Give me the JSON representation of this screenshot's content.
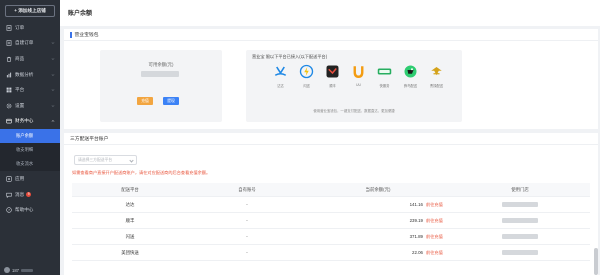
{
  "sidebar": {
    "add_store": "+ 添加线上店铺",
    "items": [
      {
        "label": "订单",
        "icon": "order-icon"
      },
      {
        "label": "自建订单",
        "icon": "create-order-icon"
      },
      {
        "label": "商品",
        "icon": "goods-icon"
      },
      {
        "label": "数据分析",
        "icon": "chart-icon"
      },
      {
        "label": "平台",
        "icon": "platform-icon"
      },
      {
        "label": "设置",
        "icon": "settings-icon"
      },
      {
        "label": "财务中心",
        "icon": "finance-icon"
      }
    ],
    "sub_items": [
      {
        "label": "账户余额",
        "active": true
      },
      {
        "label": "收支明细",
        "active": false
      },
      {
        "label": "收支流水",
        "active": false
      }
    ],
    "bottom_items": [
      {
        "label": "应用",
        "icon": "app-icon"
      },
      {
        "label": "消息",
        "icon": "message-icon",
        "badge": "9"
      },
      {
        "label": "帮助中心",
        "icon": "help-icon"
      }
    ],
    "user": {
      "name": "187"
    }
  },
  "page": {
    "title": "账户余额"
  },
  "wallet": {
    "section_title": "营业宝钱包",
    "balance_label": "可用余额(元)",
    "recharge_label": "充值",
    "withdraw_label": "提现"
  },
  "platforms": {
    "tip": "营业宝 限以下平台已接入(以下配送平台)",
    "list": [
      {
        "name": "达达",
        "color": "#1e88e5"
      },
      {
        "name": "闪送",
        "color": "#1e88e5"
      },
      {
        "name": "顺丰",
        "color": "#222222"
      },
      {
        "name": "UU",
        "color": "#f39c12"
      },
      {
        "name": "快服务",
        "color": "#27ae60"
      },
      {
        "name": "蜂鸟配送",
        "color": "#27ae60"
      },
      {
        "name": "曹操配送",
        "color": "#d4a21a"
      }
    ],
    "note": "使用营业宝钱包，一键支付配送，数据直达、更加便捷"
  },
  "third_party": {
    "section_title": "三方配送平台账户",
    "select_placeholder": "请选择三方配送平台",
    "warning": "如需查看商户直接开户配送商账户，请在对应配送商的后台查看充值余额。",
    "headers": [
      "配送平台",
      "自有账号",
      "当前余额(元)",
      "使用门店"
    ],
    "rows": [
      {
        "platform": "达达",
        "account": "-",
        "balance": "141.16",
        "action": "前往充值"
      },
      {
        "platform": "顺丰",
        "account": "-",
        "balance": "239.19",
        "action": "前往充值"
      },
      {
        "platform": "闪送",
        "account": "-",
        "balance": "371.89",
        "action": "前往充值"
      },
      {
        "platform": "美团快送",
        "account": "-",
        "balance": "22.06",
        "action": "前往充值"
      }
    ]
  },
  "colors": {
    "accent": "#3a72e8",
    "warn": "#e8533a",
    "sidebar": "#2b3038"
  }
}
